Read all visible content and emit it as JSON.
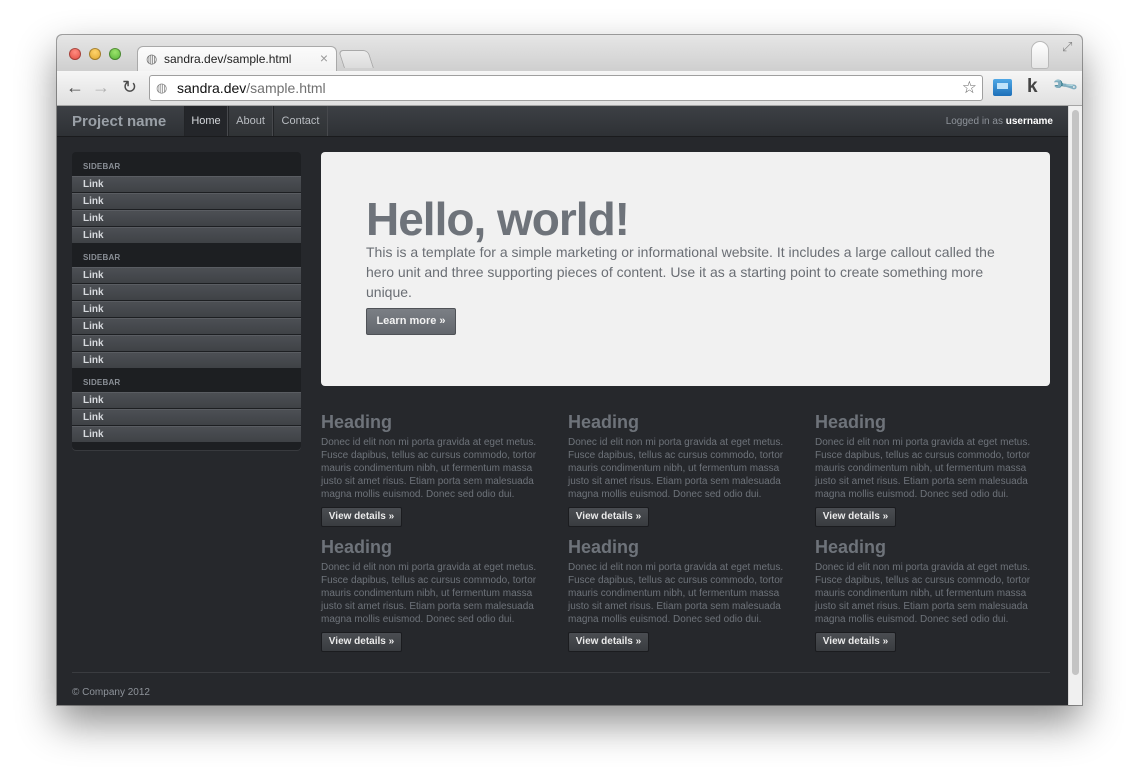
{
  "browser": {
    "tab_title": "sandra.dev/sample.html",
    "url_host": "sandra.dev",
    "url_path": "/sample.html",
    "icons": [
      "back-arrow-icon",
      "forward-arrow-icon",
      "reload-icon",
      "globe-icon",
      "bookmark-star-icon",
      "extension-icon",
      "k-icon",
      "wrench-icon"
    ]
  },
  "navbar": {
    "brand": "Project name",
    "items": [
      {
        "label": "Home",
        "active": true
      },
      {
        "label": "About",
        "active": false
      },
      {
        "label": "Contact",
        "active": false
      }
    ],
    "logged_prefix": "Logged in as",
    "username": "username"
  },
  "sidebar": {
    "sections": [
      {
        "header": "SIDEBAR",
        "links": [
          "Link",
          "Link",
          "Link",
          "Link"
        ]
      },
      {
        "header": "SIDEBAR",
        "links": [
          "Link",
          "Link",
          "Link",
          "Link",
          "Link",
          "Link"
        ]
      },
      {
        "header": "SIDEBAR",
        "links": [
          "Link",
          "Link",
          "Link"
        ]
      }
    ]
  },
  "hero": {
    "title": "Hello, world!",
    "text": "This is a template for a simple marketing or informational website. It includes a large callout called the hero unit and three supporting pieces of content. Use it as a starting point to create something more unique.",
    "button": "Learn more »"
  },
  "features": [
    {
      "heading": "Heading",
      "body": "Donec id elit non mi porta gravida at eget metus. Fusce dapibus, tellus ac cursus commodo, tortor mauris condimentum nibh, ut fermentum massa justo sit amet risus. Etiam porta sem malesuada magna mollis euismod. Donec sed odio dui.",
      "button": "View details »"
    },
    {
      "heading": "Heading",
      "body": "Donec id elit non mi porta gravida at eget metus. Fusce dapibus, tellus ac cursus commodo, tortor mauris condimentum nibh, ut fermentum massa justo sit amet risus. Etiam porta sem malesuada magna mollis euismod. Donec sed odio dui.",
      "button": "View details »"
    },
    {
      "heading": "Heading",
      "body": "Donec id elit non mi porta gravida at eget metus. Fusce dapibus, tellus ac cursus commodo, tortor mauris condimentum nibh, ut fermentum massa justo sit amet risus. Etiam porta sem malesuada magna mollis euismod. Donec sed odio dui.",
      "button": "View details »"
    },
    {
      "heading": "Heading",
      "body": "Donec id elit non mi porta gravida at eget metus. Fusce dapibus, tellus ac cursus commodo, tortor mauris condimentum nibh, ut fermentum massa justo sit amet risus. Etiam porta sem malesuada magna mollis euismod. Donec sed odio dui.",
      "button": "View details »"
    },
    {
      "heading": "Heading",
      "body": "Donec id elit non mi porta gravida at eget metus. Fusce dapibus, tellus ac cursus commodo, tortor mauris condimentum nibh, ut fermentum massa justo sit amet risus. Etiam porta sem malesuada magna mollis euismod. Donec sed odio dui.",
      "button": "View details »"
    },
    {
      "heading": "Heading",
      "body": "Donec id elit non mi porta gravida at eget metus. Fusce dapibus, tellus ac cursus commodo, tortor mauris condimentum nibh, ut fermentum massa justo sit amet risus. Etiam porta sem malesuada magna mollis euismod. Donec sed odio dui.",
      "button": "View details »"
    }
  ],
  "footer": "© Company 2012",
  "colors": {
    "page_bg": "#26282c",
    "hero_bg": "#f1f1f1",
    "muted_text": "#6e737a"
  }
}
